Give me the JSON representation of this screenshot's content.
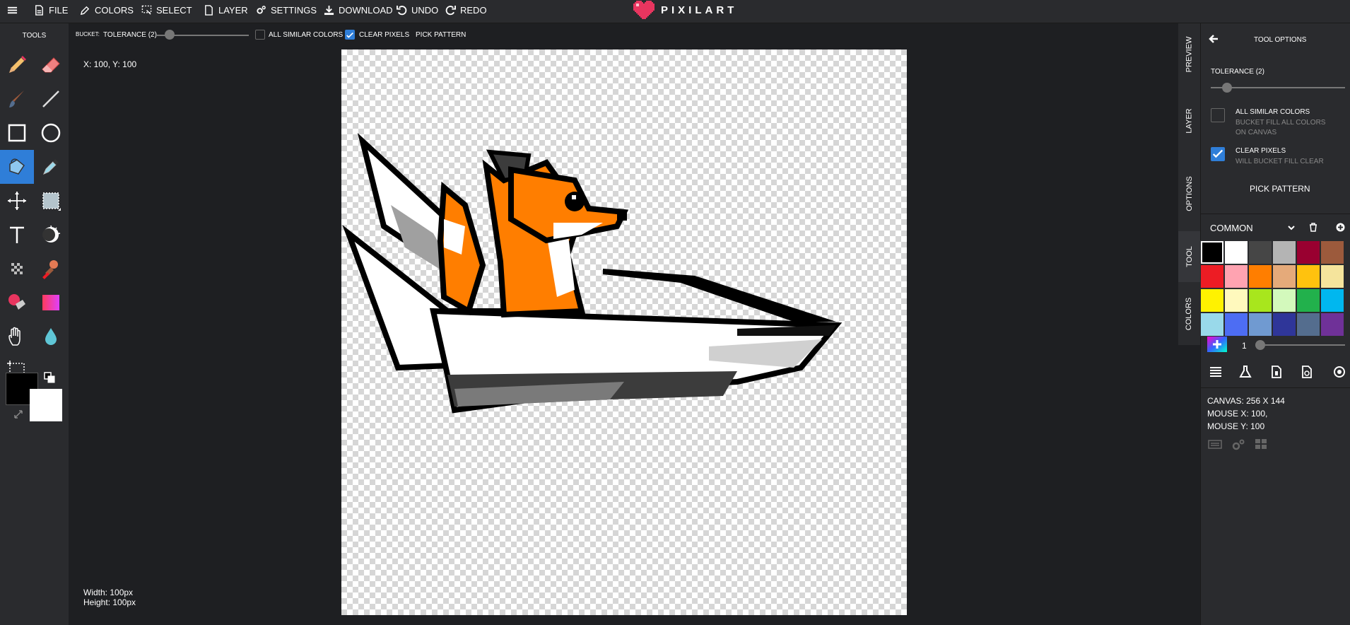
{
  "menu": {
    "file": "FILE",
    "colors": "COLORS",
    "select": "SELECT",
    "layer": "LAYER",
    "settings": "SETTINGS",
    "download": "DOWNLOAD",
    "undo": "UNDO",
    "redo": "REDO"
  },
  "logo": "PIXILART",
  "tools": {
    "title": "TOOLS",
    "items": [
      "pencil",
      "eraser",
      "brush",
      "line",
      "rectangle",
      "ellipse",
      "bucket",
      "color-picker",
      "move",
      "selection",
      "text",
      "lighten",
      "dither",
      "stamp",
      "remover",
      "gradient",
      "hand",
      "blur",
      "crop"
    ],
    "active": "bucket",
    "primary_color": "#000000",
    "secondary_color": "#ffffff"
  },
  "options_bar": {
    "bucket_label": "BUCKET:",
    "tolerance_label": "TOLERANCE (2)",
    "tolerance_value": 2,
    "all_similar_label": "ALL SIMILAR COLORS",
    "all_similar_checked": false,
    "clear_pixels_label": "CLEAR PIXELS",
    "clear_pixels_checked": true,
    "pick_pattern_label": "PICK PATTERN"
  },
  "canvas": {
    "coords": "X: 100, Y: 100",
    "width_label": "Width: 100px",
    "height_label": "Height: 100px"
  },
  "vertical_tabs": [
    "PREVIEW",
    "LAYER",
    "OPTIONS",
    "TOOL",
    "COLORS"
  ],
  "active_tab": "TOOL",
  "tool_options": {
    "title": "TOOL OPTIONS",
    "tolerance_label": "TOLERANCE (2)",
    "all_similar_title": "ALL SIMILAR COLORS",
    "all_similar_desc": "BUCKET FILL ALL COLORS ON CANVAS",
    "clear_pixels_title": "CLEAR PIXELS",
    "clear_pixels_desc": "WILL BUCKET FILL CLEAR",
    "pick_pattern": "PICK PATTERN"
  },
  "palette": {
    "name": "COMMON",
    "colors": [
      "#000000",
      "#ffffff",
      "#464646",
      "#b4b4b4",
      "#990030",
      "#9c5a3c",
      "#ed1c24",
      "#ffa3b1",
      "#ff7e00",
      "#e5aa7a",
      "#ffc20e",
      "#f5e49c",
      "#fff200",
      "#fff9bd",
      "#a8e61d",
      "#d3f9bc",
      "#22b14c",
      "#00b7ef",
      "#99d9ea",
      "#4d6df3",
      "#709ad1",
      "#2f3699",
      "#546d8e",
      "#6f3198"
    ],
    "selected_index": 0,
    "brush_size": "1"
  },
  "stats": {
    "canvas": "CANVAS: 256 X 144",
    "mouse_x": "MOUSE X: 100,",
    "mouse_y": "MOUSE Y: 100"
  },
  "colors": {
    "accent": "#2f7ed8",
    "logo_heart": "#e8355f",
    "fox_orange": "#ff7e00"
  }
}
